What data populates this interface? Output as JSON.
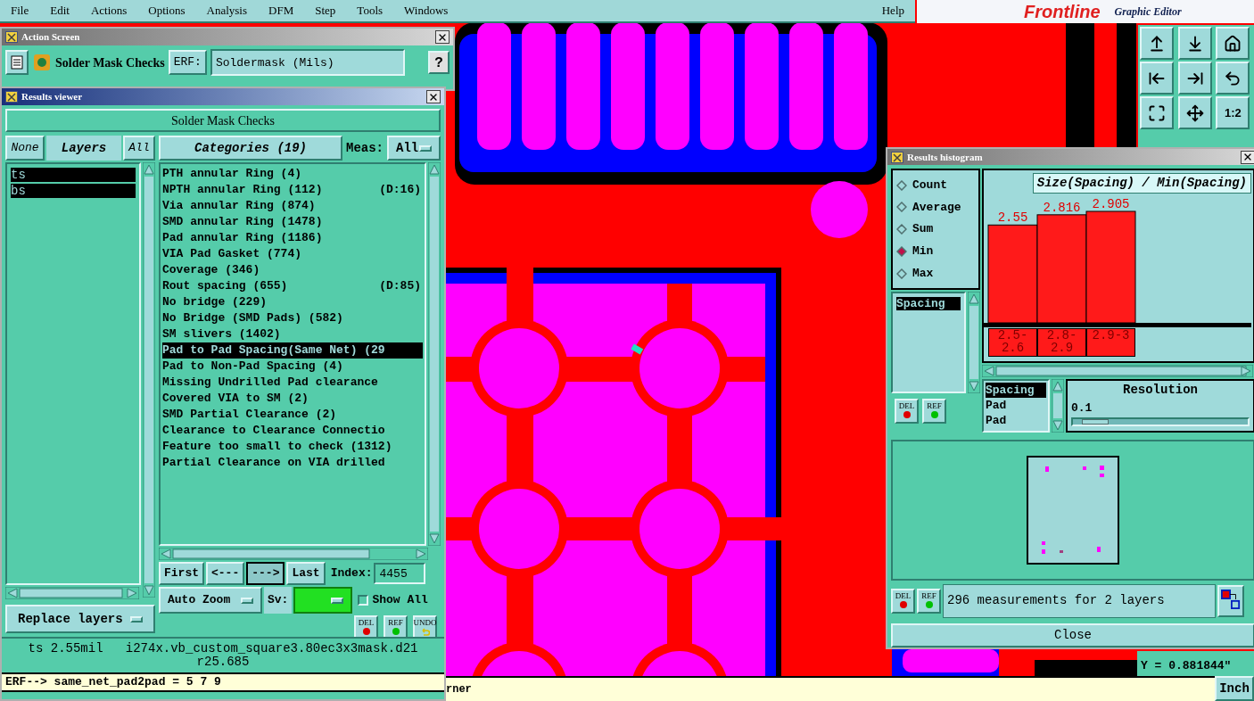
{
  "menu_bar": {
    "items": [
      "File",
      "Edit",
      "Actions",
      "Options",
      "Analysis",
      "DFM",
      "Step",
      "Tools",
      "Windows"
    ],
    "help": "Help"
  },
  "logo": {
    "brand": "Frontline",
    "product": "Graphic Editor"
  },
  "action_screen": {
    "title": "Action Screen",
    "label": "Solder Mask Checks",
    "erf_button": "ERF:",
    "erf_value": "Soldermask (Mils)",
    "help_button": "?"
  },
  "results_viewer": {
    "title": "Results viewer",
    "header": "Solder Mask Checks",
    "none_button": "None",
    "layers_label": "Layers",
    "all_button": "All",
    "layers": [
      {
        "name": "ts",
        "selected": true
      },
      {
        "name": "bs",
        "selected": true
      }
    ],
    "replace_layers": "Replace layers",
    "categories_button": "Categories (19)",
    "meas_label": "Meas:",
    "meas_value": "All",
    "categories": [
      {
        "name": "PTH annular Ring (4)",
        "selected": false
      },
      {
        "name": "NPTH annular Ring (112)",
        "note": "(D:16)",
        "selected": false
      },
      {
        "name": "Via annular Ring (874)",
        "selected": false
      },
      {
        "name": "SMD annular Ring (1478)",
        "selected": false
      },
      {
        "name": "Pad annular Ring (1186)",
        "selected": false
      },
      {
        "name": "VIA Pad Gasket (774)",
        "selected": false
      },
      {
        "name": "Coverage (346)",
        "selected": false
      },
      {
        "name": "Rout spacing (655)",
        "note": "(D:85)",
        "selected": false
      },
      {
        "name": "No bridge (229)",
        "selected": false
      },
      {
        "name": "No Bridge (SMD Pads) (582)",
        "selected": false
      },
      {
        "name": "SM slivers (1402)",
        "selected": false
      },
      {
        "name": "Pad to Pad Spacing(Same Net) (29",
        "selected": true
      },
      {
        "name": "Pad to Non-Pad Spacing (4)",
        "selected": false
      },
      {
        "name": "Missing Undrilled Pad clearance",
        "selected": false
      },
      {
        "name": "Covered VIA to SM (2)",
        "selected": false
      },
      {
        "name": "SMD Partial Clearance (2)",
        "selected": false
      },
      {
        "name": "Clearance to Clearance Connectio",
        "selected": false
      },
      {
        "name": "Feature too small to check (1312)",
        "selected": false
      },
      {
        "name": "Partial Clearance on VIA drilled",
        "selected": false
      }
    ],
    "nav_buttons": [
      {
        "label": "First",
        "selected": false
      },
      {
        "label": "<---",
        "selected": false
      },
      {
        "label": "--->",
        "selected": true
      },
      {
        "label": "Last",
        "selected": false
      }
    ],
    "index_label": "Index:",
    "index_value": "4455",
    "zoom_mode": "Auto Zoom",
    "sv_label": "Sv:",
    "show_all": {
      "label": "Show All",
      "checked": false
    },
    "tool_buttons": [
      {
        "kind": "del",
        "label": "DEL"
      },
      {
        "kind": "ref",
        "label": "REF"
      },
      {
        "kind": "undo",
        "label": "UNDO"
      }
    ],
    "info_lines": [
      "ts 2.55mil   i274x.vb_custom_square3.80ec3x3mask.d21",
      "r25.685"
    ],
    "erf_line": "ERF--> same_net_pad2pad = 5 7 9"
  },
  "histogram": {
    "title": "Results histogram",
    "modes": [
      {
        "label": "Count",
        "selected": false
      },
      {
        "label": "Average",
        "selected": false
      },
      {
        "label": "Sum",
        "selected": false
      },
      {
        "label": "Min",
        "selected": true
      },
      {
        "label": "Max",
        "selected": false
      }
    ],
    "fields": [
      {
        "name": "Spacing",
        "selected": true
      }
    ],
    "side_buttons": [
      {
        "kind": "del",
        "label": "DEL"
      },
      {
        "kind": "ref",
        "label": "REF"
      }
    ],
    "chart_data": {
      "type": "bar",
      "title": "Size(Spacing) / Min(Spacing)",
      "categories": [
        "2.5-2.6",
        "2.8-2.9",
        "2.9-3"
      ],
      "values": [
        2.55,
        2.816,
        2.905
      ],
      "data_labels": true
    },
    "attributes": [
      {
        "name": "Spacing",
        "selected": true
      },
      {
        "name": "Pad",
        "selected": false
      },
      {
        "name": "Pad",
        "selected": false
      }
    ],
    "resolution_label": "Resolution",
    "resolution_value": "0.1",
    "resolution_slider": {
      "level": 0.05
    },
    "bottom_buttons": [
      {
        "kind": "del",
        "label": "DEL"
      },
      {
        "kind": "ref",
        "label": "REF"
      }
    ],
    "summary": "296 measurements for 2 layers",
    "close_button": "Close"
  },
  "toolbar": {
    "buttons": [
      {
        "kind": "up"
      },
      {
        "kind": "down"
      },
      {
        "kind": "home"
      },
      {
        "kind": "left"
      },
      {
        "kind": "right"
      },
      {
        "kind": "undo"
      },
      {
        "kind": "fit"
      },
      {
        "kind": "move"
      },
      {
        "kind": "scale",
        "label": "1:2"
      }
    ]
  },
  "coordinates": {
    "y": "Y = 0.881844\""
  },
  "status_bar": {
    "message": "rner",
    "units_button": "Inch"
  }
}
